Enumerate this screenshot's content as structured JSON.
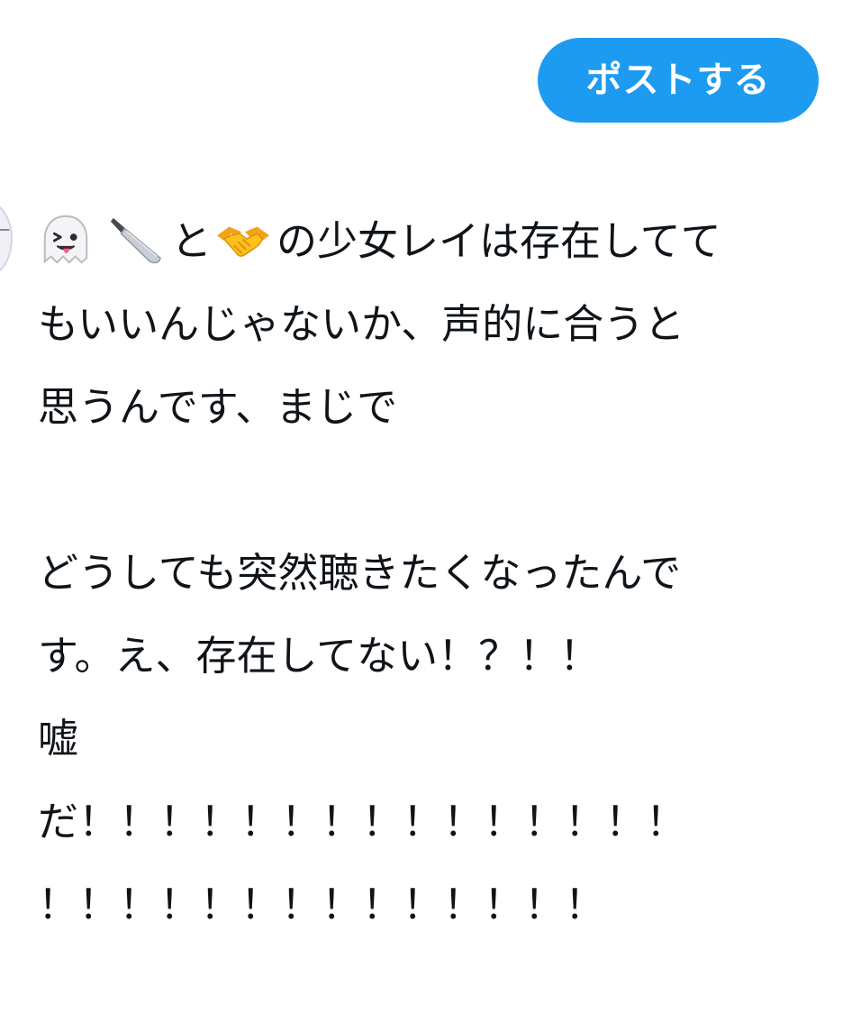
{
  "toolbar": {
    "post_button_label": "ポストする"
  },
  "compose": {
    "emojis": [
      "ghost-face-emoji",
      "kitchen-knife-emoji",
      "handshake-emoji"
    ],
    "line1_connector": "と",
    "line1_rest": "の少女レイは存在してて",
    "lines": [
      "もいいんじゃないか、声的に合うと",
      "思うんです、まじで",
      "",
      "どうしても突然聴きたくなったんで",
      "す。え、存在してない！？！！",
      "嘘",
      "だ！！！！！！！！！！！！！！！",
      "！！！！！！！！！！！！！！"
    ]
  },
  "colors": {
    "accent": "#1d9bf0",
    "text": "#0f1419",
    "background": "#ffffff"
  }
}
